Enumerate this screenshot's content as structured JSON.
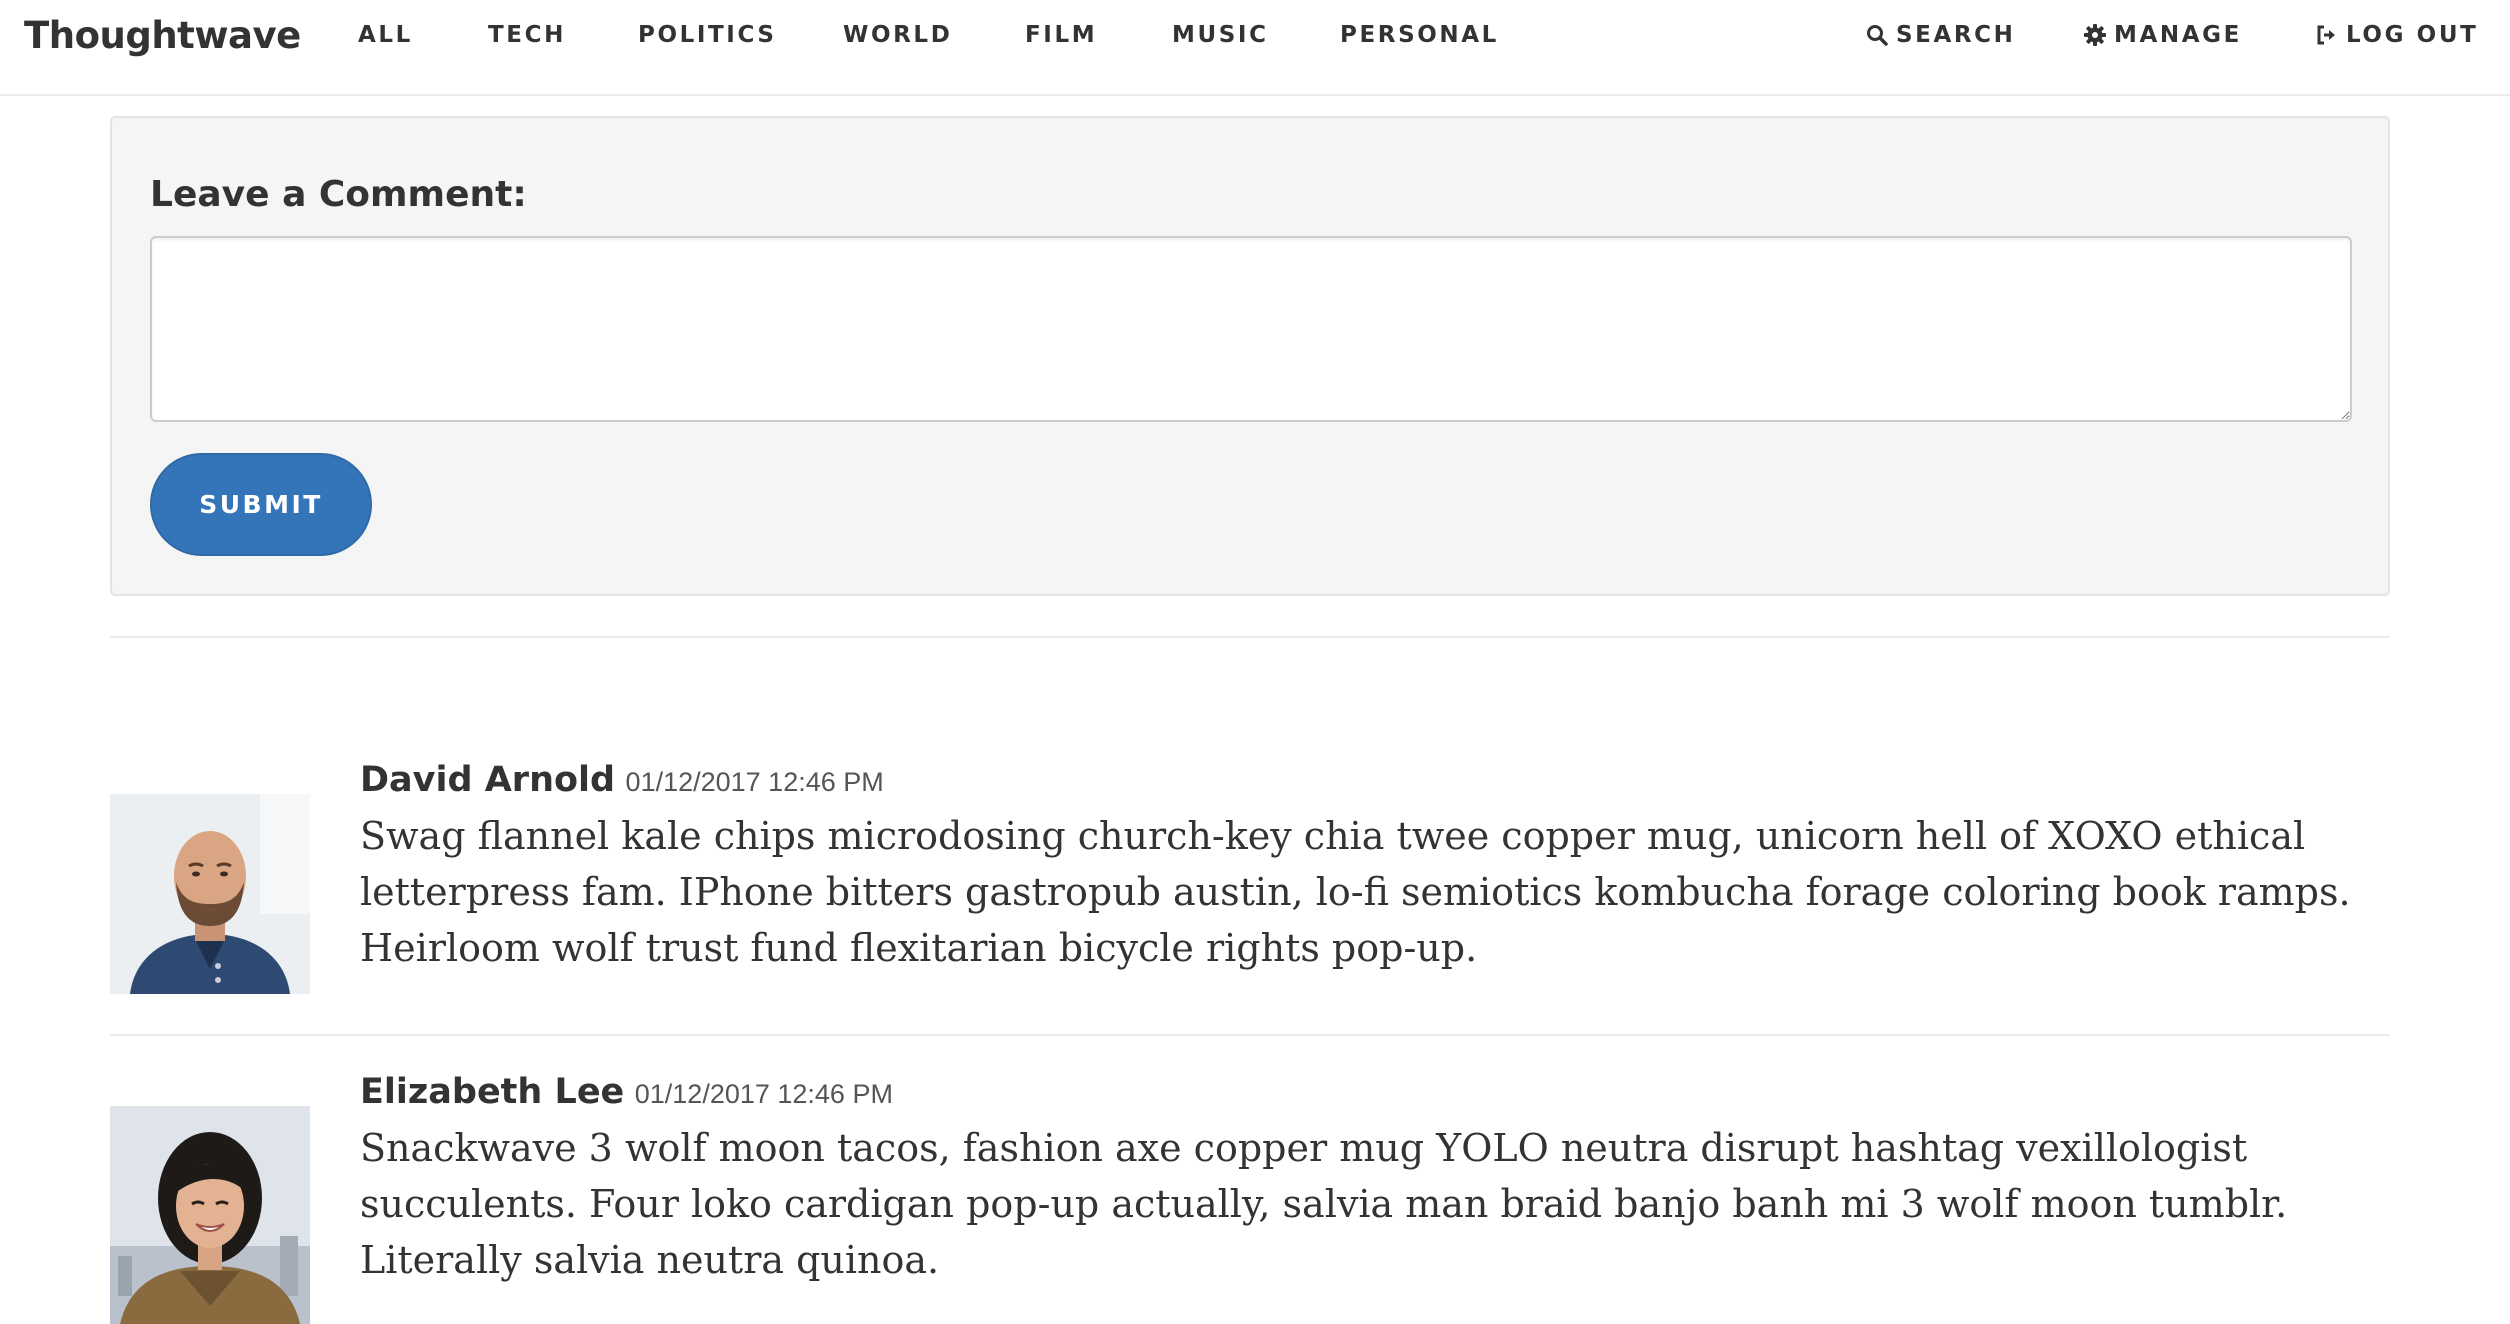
{
  "nav": {
    "brand": "Thoughtwave",
    "links": [
      "ALL",
      "TECH",
      "POLITICS",
      "WORLD",
      "FILM",
      "MUSIC",
      "PERSONAL"
    ],
    "search_label": "SEARCH",
    "manage_label": "MANAGE",
    "logout_label": "LOG OUT",
    "icons": {
      "search": "search-icon",
      "manage": "gear-icon",
      "logout": "logout-icon"
    }
  },
  "comment_form": {
    "label": "Leave a Comment:",
    "textarea_value": "",
    "submit_label": "SUBMIT",
    "accent_color": "#3375b8"
  },
  "comments": [
    {
      "author": "David Arnold",
      "timestamp": "01/12/2017 12:46 PM",
      "text": "Swag flannel kale chips microdosing church-key chia twee copper mug, unicorn hell of XOXO ethical letterpress fam. IPhone bitters gastropub austin, lo-fi semiotics kombucha forage coloring book ramps. Heirloom wolf trust fund flexitarian bicycle rights pop-up."
    },
    {
      "author": "Elizabeth Lee",
      "timestamp": "01/12/2017 12:46 PM",
      "text": "Snackwave 3 wolf moon tacos, fashion axe copper mug YOLO neutra disrupt hashtag vexillologist succulents. Four loko cardigan pop-up actually, salvia man braid banjo banh mi 3 wolf moon tumblr. Literally salvia neutra quinoa."
    }
  ]
}
